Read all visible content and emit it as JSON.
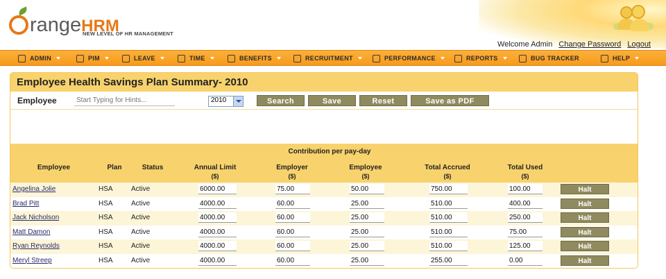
{
  "brand": {
    "logo_word": "range",
    "logo_hrm": "HRM",
    "tagline": "NEW LEVEL OF HR MANAGEMENT"
  },
  "header": {
    "welcome": "Welcome Admin",
    "change_password": "Change Password",
    "logout": "Logout"
  },
  "menu": [
    {
      "label": "ADMIN"
    },
    {
      "label": "PIM"
    },
    {
      "label": "LEAVE"
    },
    {
      "label": "TIME"
    },
    {
      "label": "BENEFITS"
    },
    {
      "label": "RECRUITMENT"
    },
    {
      "label": "PERFORMANCE"
    },
    {
      "label": "REPORTS"
    },
    {
      "label": "BUG TRACKER"
    },
    {
      "label": "HELP"
    }
  ],
  "page": {
    "title": "Employee Health Savings Plan Summary- 2010"
  },
  "toolbar": {
    "employee_label": "Employee",
    "employee_placeholder": "Start Typing for Hints...",
    "year_value": "2010",
    "search": "Search",
    "save": "Save",
    "reset": "Reset",
    "save_pdf": "Save as PDF"
  },
  "table": {
    "group_header": "Contribution per pay-day",
    "columns": {
      "employee": "Employee",
      "plan": "Plan",
      "status": "Status",
      "annual_limit": "Annual Limit",
      "employer": "Employer",
      "employee_contrib": "Employee",
      "total_accrued": "Total Accrued",
      "total_used": "Total Used",
      "unit": "($)"
    },
    "halt_label": "Halt",
    "rows": [
      {
        "name": "Angelina Jolie",
        "plan": "HSA",
        "status": "Active",
        "annual_limit": "6000.00",
        "employer": "75.00",
        "employee": "50.00",
        "accrued": "750.00",
        "used": "100.00"
      },
      {
        "name": "Brad Pitt",
        "plan": "HSA",
        "status": "Active",
        "annual_limit": "4000.00",
        "employer": "60.00",
        "employee": "25.00",
        "accrued": "510.00",
        "used": "400.00"
      },
      {
        "name": "Jack Nicholson",
        "plan": "HSA",
        "status": "Active",
        "annual_limit": "4000.00",
        "employer": "60.00",
        "employee": "25.00",
        "accrued": "510.00",
        "used": "250.00"
      },
      {
        "name": "Matt Damon",
        "plan": "HSA",
        "status": "Active",
        "annual_limit": "4000.00",
        "employer": "60.00",
        "employee": "25.00",
        "accrued": "510.00",
        "used": "75.00"
      },
      {
        "name": "Ryan Reynolds",
        "plan": "HSA",
        "status": "Active",
        "annual_limit": "4000.00",
        "employer": "60.00",
        "employee": "25.00",
        "accrued": "510.00",
        "used": "125.00"
      },
      {
        "name": "Meryl Streep",
        "plan": "HSA",
        "status": "Active",
        "annual_limit": "4000.00",
        "employer": "60.00",
        "employee": "25.00",
        "accrued": "255.00",
        "used": "0.00"
      }
    ]
  },
  "colors": {
    "accent": "#f79a1c",
    "panel_header": "#f8d26c",
    "button": "#8f8a5f"
  }
}
